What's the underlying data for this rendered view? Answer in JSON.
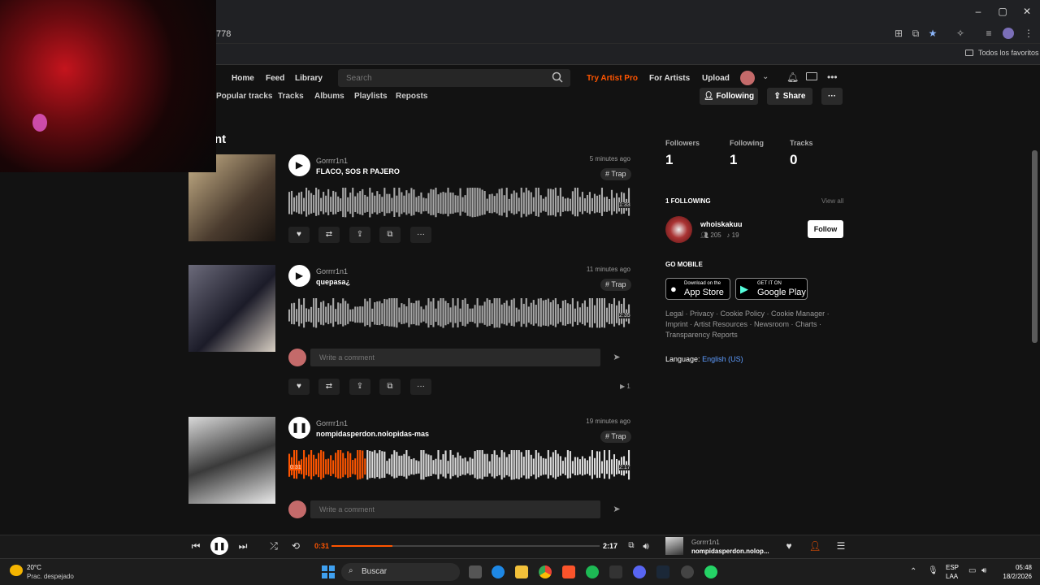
{
  "browser": {
    "address_fragment": "778",
    "bookmarks_folder": "Todos los favoritos"
  },
  "nav": {
    "home": "Home",
    "feed": "Feed",
    "library": "Library",
    "search_placeholder": "Search",
    "try_pro": "Try Artist Pro",
    "for_artists": "For Artists",
    "upload": "Upload"
  },
  "profile_tabs": [
    "Popular tracks",
    "Tracks",
    "Albums",
    "Playlists",
    "Reposts"
  ],
  "profile_actions": {
    "following": "Following",
    "share": "Share",
    "more": "···"
  },
  "section_heading_partial": "nt",
  "tracks": [
    {
      "artist": "Gorrrr1n1",
      "title": "FLACO, SOS R PAJERO",
      "ago": "5 minutes ago",
      "tag": "# Trap",
      "duration": "1:33",
      "progress": 0,
      "playing": false,
      "colors": [
        "#c9b38a",
        "#4a3b2e"
      ]
    },
    {
      "artist": "Gorrrr1n1",
      "title": "quepasa¿",
      "ago": "11 minutes ago",
      "tag": "# Trap",
      "duration": "2:35",
      "progress": 0,
      "playing": false,
      "comment_placeholder": "Write a comment",
      "plays": "1",
      "colors": [
        "#6b6a7a",
        "#1b1b28"
      ]
    },
    {
      "artist": "Gorrrr1n1",
      "title": "nompidasperdon.nolopidas-mas",
      "ago": "19 minutes ago",
      "tag": "# Trap",
      "duration": "2:17",
      "elapsed": "0:31",
      "progress": 0.226,
      "playing": true,
      "comment_placeholder": "Write a comment",
      "colors": [
        "#d9d9d9",
        "#3a3a3a"
      ]
    }
  ],
  "stats": [
    {
      "label": "Followers",
      "value": "1"
    },
    {
      "label": "Following",
      "value": "1"
    },
    {
      "label": "Tracks",
      "value": "0"
    }
  ],
  "following_section": {
    "heading": "1 FOLLOWING",
    "view_all": "View all",
    "user": {
      "name": "whoiskakuu",
      "followers": "205",
      "tracks": "19",
      "follow": "Follow"
    }
  },
  "go_mobile": {
    "heading": "GO MOBILE",
    "appstore_small": "Download on the",
    "appstore": "App Store",
    "play_small": "GET IT ON",
    "play": "Google Play"
  },
  "footer_links": "Legal · Privacy · Cookie Policy · Cookie Manager · Imprint · Artist Resources · Newsroom · Charts · Transparency Reports",
  "language": {
    "label": "Language:",
    "value": "English (US)"
  },
  "player": {
    "elapsed": "0:31",
    "total": "2:17",
    "progress": 0.226,
    "artist": "Gorrrr1n1",
    "title": "nompidasperdon.nolop..."
  },
  "taskbar": {
    "temp": "20°C",
    "weather": "Prac. despejado",
    "search": "Buscar",
    "lang1": "ESP",
    "lang2": "LAA",
    "time": "05:48",
    "date": "18/2/2026"
  },
  "colors": {
    "accent": "#ff5500",
    "link": "#5e9cff",
    "bg": "#121212"
  }
}
